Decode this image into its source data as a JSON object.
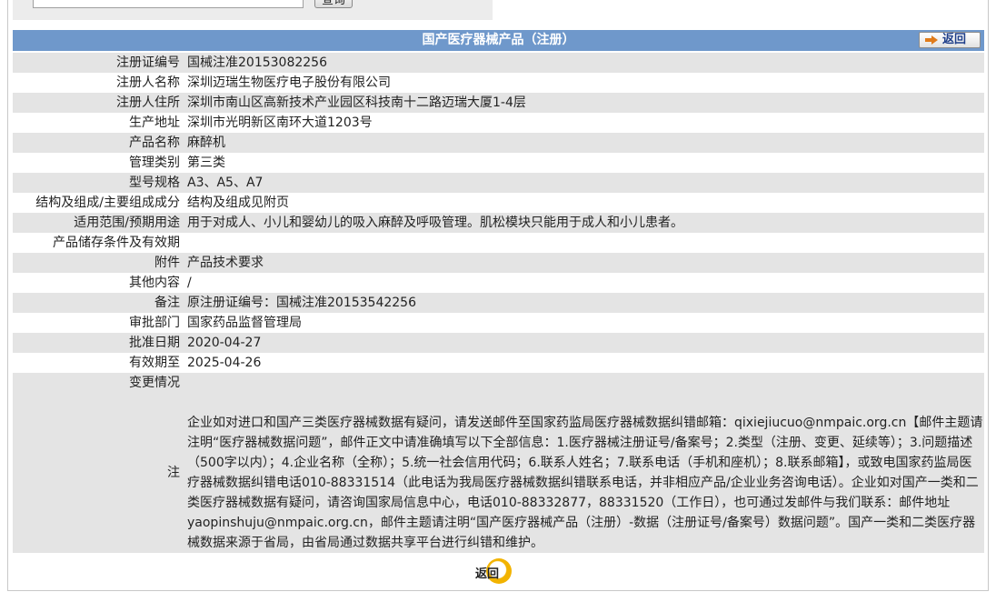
{
  "search": {
    "button_label": "查询",
    "input_value": ""
  },
  "header": {
    "title": "国产医疗器械产品（注册）",
    "back_label": "返回"
  },
  "rows": [
    {
      "key": "注册证编号",
      "value": "国械注准20153082256"
    },
    {
      "key": "注册人名称",
      "value": "深圳迈瑞生物医疗电子股份有限公司"
    },
    {
      "key": "注册人住所",
      "value": "深圳市南山区高新技术产业园区科技南十二路迈瑞大厦1-4层"
    },
    {
      "key": "生产地址",
      "value": "深圳市光明新区南环大道1203号"
    },
    {
      "key": "产品名称",
      "value": "麻醉机"
    },
    {
      "key": "管理类别",
      "value": "第三类"
    },
    {
      "key": "型号规格",
      "value": "A3、A5、A7"
    },
    {
      "key": "结构及组成/主要组成成分",
      "value": "结构及组成见附页"
    },
    {
      "key": "适用范围/预期用途",
      "value": "用于对成人、小儿和婴幼儿的吸入麻醉及呼吸管理。肌松模块只能用于成人和小儿患者。"
    },
    {
      "key": "产品储存条件及有效期",
      "value": ""
    },
    {
      "key": "附件",
      "value": "产品技术要求"
    },
    {
      "key": "其他内容",
      "value": "/"
    },
    {
      "key": "备注",
      "value": "原注册证编号：国械注准20153542256"
    },
    {
      "key": "审批部门",
      "value": "国家药品监督管理局"
    },
    {
      "key": "批准日期",
      "value": "2020-04-27"
    },
    {
      "key": "有效期至",
      "value": "2025-04-26"
    },
    {
      "key": "变更情况",
      "value": ""
    }
  ],
  "note": {
    "key": "注",
    "text": "企业如对进口和国产三类医疗器械数据有疑问，请发送邮件至国家药监局医疗器械数据纠错邮箱：qixiejiucuo@nmpaic.org.cn【邮件主题请注明“医疗器械数据问题”，邮件正文中请准确填写以下全部信息：1.医疗器械注册证号/备案号；2.类型（注册、变更、延续等）；3.问题描述（500字以内）；4.企业名称（全称）；5.统一社会信用代码；6.联系人姓名；7.联系电话（手机和座机）；8.联系邮箱】，或致电国家药监局医疗器械数据纠错电话010-88331514（此电话为我局医疗器械数据纠错联系电话，并非相应产品/企业业务咨询电话）。企业如对国产一类和二类医疗器械数据有疑问，请咨询国家局信息中心，电话010-88332877，88331520（工作日），也可通过发邮件与我们联系：邮件地址yaopinshuju@nmpaic.org.cn，邮件主题请注明“国产医疗器械产品（注册）-数据（注册证号/备案号）数据问题”。国产一类和二类医疗器械数据来源于省局，由省局通过数据共享平台进行纠错和维护。"
  },
  "footer": {
    "back_label": "返回"
  }
}
